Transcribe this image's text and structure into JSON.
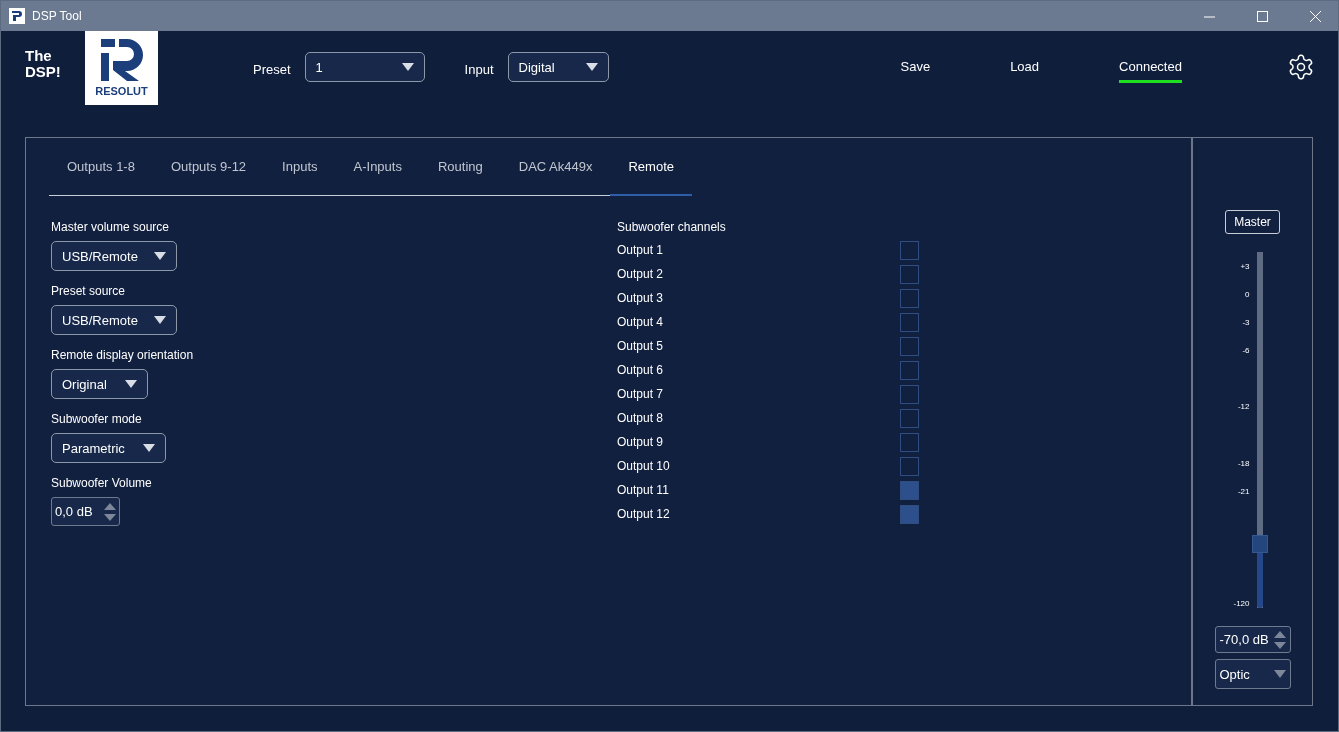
{
  "window": {
    "title": "DSP Tool"
  },
  "header": {
    "brand": "The DSP!",
    "logo_text": "RESOLUT",
    "preset": {
      "label": "Preset",
      "value": "1"
    },
    "input": {
      "label": "Input",
      "value": "Digital"
    },
    "actions": [
      "Save",
      "Load"
    ],
    "status": {
      "label": "Connected",
      "connected": true
    }
  },
  "tabs": [
    {
      "label": "Outputs 1-8",
      "selected": false
    },
    {
      "label": "Outputs 9-12",
      "selected": false
    },
    {
      "label": "Inputs",
      "selected": false
    },
    {
      "label": "A-Inputs",
      "selected": false
    },
    {
      "label": "Routing",
      "selected": false
    },
    {
      "label": "DAC Ak449x",
      "selected": false
    },
    {
      "label": "Remote",
      "selected": true
    }
  ],
  "settings": [
    {
      "kind": "select",
      "label": "Master volume source",
      "value": "USB/Remote"
    },
    {
      "kind": "select",
      "label": "Preset source",
      "value": "USB/Remote"
    },
    {
      "kind": "select",
      "label": "Remote display orientation",
      "value": "Original"
    },
    {
      "kind": "select",
      "label": "Subwoofer mode",
      "value": "Parametric"
    },
    {
      "kind": "spin",
      "label": "Subwoofer Volume",
      "value": "0,0 dB"
    }
  ],
  "subwoofer_channels": {
    "title": "Subwoofer channels",
    "outputs": [
      {
        "label": "Output 1",
        "checked": false
      },
      {
        "label": "Output 2",
        "checked": false
      },
      {
        "label": "Output 3",
        "checked": false
      },
      {
        "label": "Output 4",
        "checked": false
      },
      {
        "label": "Output 5",
        "checked": false
      },
      {
        "label": "Output 6",
        "checked": false
      },
      {
        "label": "Output 7",
        "checked": false
      },
      {
        "label": "Output 8",
        "checked": false
      },
      {
        "label": "Output 9",
        "checked": false
      },
      {
        "label": "Output 10",
        "checked": false
      },
      {
        "label": "Output 11",
        "checked": true
      },
      {
        "label": "Output 12",
        "checked": true
      }
    ]
  },
  "master": {
    "button": "Master",
    "ticks": [
      "+3",
      "0",
      "-3",
      "-6",
      "-12",
      "-18",
      "-21",
      "-120"
    ],
    "level": 0.18,
    "value": "-70,0 dB",
    "source": "Optic"
  }
}
